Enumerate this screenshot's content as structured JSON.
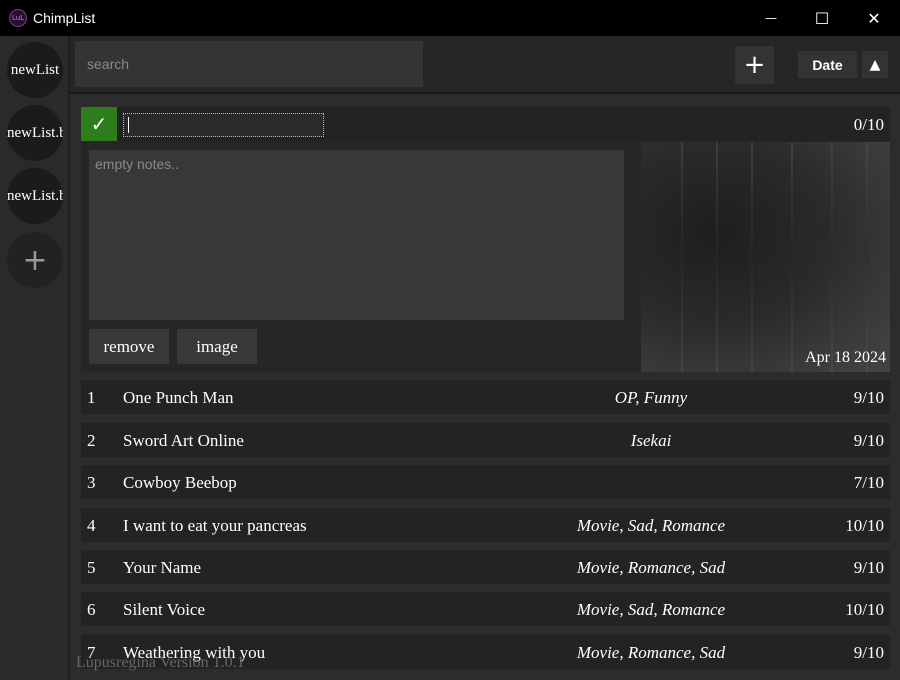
{
  "window": {
    "title": "ChimpList",
    "icon_label": "LuL",
    "minimize": "—",
    "maximize": "☐",
    "close": "✕"
  },
  "sidebar": {
    "lists": [
      {
        "label": "newList"
      },
      {
        "label": "newList.b"
      },
      {
        "label": "newList.b"
      }
    ],
    "add_label": "+"
  },
  "toolbar": {
    "search_placeholder": "search",
    "add_label": "+",
    "sort_label": "Date",
    "sort_direction": "▲"
  },
  "editor": {
    "check_label": "✓",
    "title_value": "",
    "score": "0/10",
    "notes_placeholder": "empty notes..",
    "remove_label": "remove",
    "image_label": "image",
    "date": "Apr 18 2024"
  },
  "entries": [
    {
      "rank": "1",
      "name": "One Punch Man",
      "tags": "OP, Funny",
      "score": "9/10"
    },
    {
      "rank": "2",
      "name": "Sword Art Online",
      "tags": "Isekai",
      "score": "9/10"
    },
    {
      "rank": "3",
      "name": "Cowboy Beebop",
      "tags": "",
      "score": "7/10"
    },
    {
      "rank": "4",
      "name": "I want to eat your pancreas",
      "tags": "Movie, Sad, Romance",
      "score": "10/10"
    },
    {
      "rank": "5",
      "name": "Your Name",
      "tags": "Movie, Romance, Sad",
      "score": "9/10"
    },
    {
      "rank": "6",
      "name": "Silent Voice",
      "tags": "Movie, Sad, Romance",
      "score": "10/10"
    },
    {
      "rank": "7",
      "name": "Weathering with you",
      "tags": "Movie, Romance, Sad",
      "score": "9/10"
    }
  ],
  "footer": {
    "version_text": "Lupusregina Version 1.0.1"
  },
  "colors": {
    "check_green": "#2e7d1d",
    "background": "#2b2b2b",
    "row_background": "#232323"
  }
}
